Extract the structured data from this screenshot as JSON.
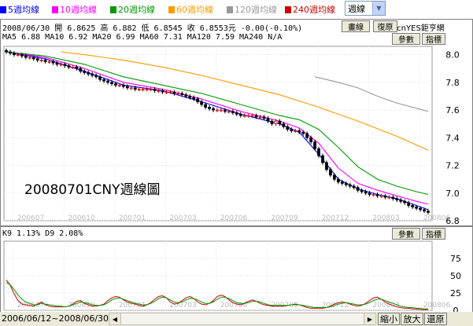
{
  "legend": [
    {
      "label": "5週均線",
      "color": "#0000ff"
    },
    {
      "label": "10週均線",
      "color": "#ff00ff"
    },
    {
      "label": "20週均線",
      "color": "#009900"
    },
    {
      "label": "60週均線",
      "color": "#ff9900"
    },
    {
      "label": "120週均線",
      "color": "#999999"
    },
    {
      "label": "240週均線",
      "color": "#cc0000"
    }
  ],
  "period_select": {
    "value": "週線"
  },
  "main_panel": {
    "info": "2008/06/30 開 6.8625 高 6.882 低 6.8545 收 6.8553元 -0.00(-0.10%)",
    "ma": "MA5 6.88  MA10 6.92  MA20 6.99  MA60 7.31  MA120 7.59  MA240 N/A",
    "copyright": "© cnYES鉅亨網",
    "buttons": {
      "draw": "畫線",
      "restore": "復原",
      "params": "參數",
      "indicator": "指標"
    },
    "watermark": "20080701CNY週線圖"
  },
  "sub_panel": {
    "info": "K9 1.13%  D9 2.08%",
    "buttons": {
      "params": "參數",
      "indicator": "指標"
    }
  },
  "bottom_bar": {
    "range": "2006/06/12~2008/06/30",
    "zoom_out": "縮小",
    "zoom_in": "放大",
    "reset": "還原"
  },
  "chart_data": [
    {
      "type": "candlestick",
      "x_ticks": [
        "200607",
        "200610",
        "200701",
        "200703",
        "200706",
        "200709",
        "200712",
        "200803",
        "200806"
      ],
      "y_ticks": [
        6.8,
        7.0,
        7.2,
        7.4,
        7.6,
        7.8,
        8.0
      ],
      "ylim": [
        6.8,
        8.06
      ],
      "close": [
        8.02,
        8.01,
        8.0,
        8.0,
        7.99,
        7.98,
        7.98,
        7.97,
        7.96,
        7.96,
        7.95,
        7.95,
        7.94,
        7.93,
        7.93,
        7.92,
        7.91,
        7.91,
        7.9,
        7.88,
        7.87,
        7.86,
        7.85,
        7.84,
        7.82,
        7.81,
        7.8,
        7.79,
        7.78,
        7.78,
        7.77,
        7.76,
        7.76,
        7.75,
        7.75,
        7.75,
        7.75,
        7.75,
        7.74,
        7.74,
        7.73,
        7.73,
        7.73,
        7.72,
        7.72,
        7.71,
        7.7,
        7.69,
        7.68,
        7.66,
        7.64,
        7.62,
        7.61,
        7.6,
        7.6,
        7.6,
        7.59,
        7.59,
        7.58,
        7.57,
        7.56,
        7.56,
        7.56,
        7.56,
        7.55,
        7.55,
        7.54,
        7.52,
        7.5,
        7.52,
        7.5,
        7.48,
        7.46,
        7.45,
        7.45,
        7.44,
        7.43,
        7.4,
        7.37,
        7.32,
        7.27,
        7.22,
        7.17,
        7.13,
        7.1,
        7.08,
        7.07,
        7.06,
        7.05,
        7.04,
        7.02,
        7.01,
        7.0,
        6.99,
        6.99,
        6.98,
        6.98,
        6.97,
        6.97,
        6.96,
        6.95,
        6.94,
        6.93,
        6.91,
        6.9,
        6.89,
        6.88,
        6.87,
        6.86
      ],
      "ma_series": [
        {
          "name": "5週均線",
          "points": [
            [
              0,
              8.02
            ],
            [
              10,
              7.97
            ],
            [
              20,
              7.88
            ],
            [
              30,
              7.78
            ],
            [
              40,
              7.74
            ],
            [
              50,
              7.66
            ],
            [
              60,
              7.57
            ],
            [
              70,
              7.5
            ],
            [
              75,
              7.44
            ],
            [
              80,
              7.28
            ],
            [
              85,
              7.1
            ],
            [
              90,
              7.03
            ],
            [
              95,
              6.99
            ],
            [
              100,
              6.96
            ],
            [
              105,
              6.91
            ],
            [
              108,
              6.88
            ]
          ]
        },
        {
          "name": "10週均線",
          "points": [
            [
              0,
              8.02
            ],
            [
              10,
              7.98
            ],
            [
              20,
              7.9
            ],
            [
              30,
              7.8
            ],
            [
              40,
              7.75
            ],
            [
              50,
              7.68
            ],
            [
              60,
              7.59
            ],
            [
              70,
              7.52
            ],
            [
              75,
              7.47
            ],
            [
              80,
              7.36
            ],
            [
              85,
              7.18
            ],
            [
              90,
              7.07
            ],
            [
              95,
              7.02
            ],
            [
              100,
              6.98
            ],
            [
              105,
              6.94
            ],
            [
              108,
              6.92
            ]
          ]
        },
        {
          "name": "20週均線",
          "points": [
            [
              0,
              8.02
            ],
            [
              10,
              7.99
            ],
            [
              20,
              7.93
            ],
            [
              30,
              7.84
            ],
            [
              40,
              7.78
            ],
            [
              50,
              7.72
            ],
            [
              60,
              7.64
            ],
            [
              70,
              7.56
            ],
            [
              75,
              7.53
            ],
            [
              80,
              7.46
            ],
            [
              85,
              7.33
            ],
            [
              90,
              7.19
            ],
            [
              95,
              7.1
            ],
            [
              100,
              7.05
            ],
            [
              105,
              7.01
            ],
            [
              108,
              6.99
            ]
          ]
        },
        {
          "name": "60週均線",
          "points": [
            [
              14,
              8.02
            ],
            [
              20,
              8.0
            ],
            [
              30,
              7.96
            ],
            [
              40,
              7.91
            ],
            [
              50,
              7.85
            ],
            [
              60,
              7.78
            ],
            [
              70,
              7.71
            ],
            [
              80,
              7.62
            ],
            [
              90,
              7.52
            ],
            [
              100,
              7.41
            ],
            [
              108,
              7.31
            ]
          ]
        },
        {
          "name": "120週均線",
          "points": [
            [
              79,
              7.84
            ],
            [
              85,
              7.8
            ],
            [
              90,
              7.76
            ],
            [
              95,
              7.7
            ],
            [
              100,
              7.65
            ],
            [
              108,
              7.59
            ]
          ]
        }
      ]
    },
    {
      "type": "line",
      "series": [
        {
          "name": "K9",
          "color": "#cc0000"
        },
        {
          "name": "D9",
          "color": "#009900"
        }
      ],
      "ylim": [
        0,
        100
      ],
      "y_ticks": [
        0,
        25,
        50,
        75
      ],
      "x_ticks": [
        "200607",
        "200610",
        "200701",
        "200703",
        "200706",
        "200709",
        "200712",
        "200803",
        "200806"
      ],
      "k": [
        44,
        36,
        24,
        14,
        9,
        8,
        7,
        6,
        9,
        12,
        8,
        6,
        5,
        5,
        5,
        5,
        6,
        9,
        13,
        14,
        10,
        8,
        6,
        6,
        7,
        9,
        14,
        18,
        20,
        19,
        15,
        12,
        10,
        9,
        7,
        6,
        8,
        11,
        16,
        20,
        21,
        18,
        12,
        9,
        10,
        14,
        18,
        20,
        17,
        12,
        9,
        8,
        10,
        14,
        20,
        22,
        20,
        15,
        11,
        9,
        8,
        10,
        13,
        15,
        13,
        10,
        8,
        7,
        6,
        6,
        6,
        6,
        7,
        8,
        9,
        8,
        6,
        4,
        3,
        3,
        3,
        3,
        4,
        6,
        9,
        11,
        12,
        11,
        9,
        7,
        6,
        7,
        10,
        14,
        18,
        19,
        16,
        12,
        9,
        7,
        5,
        4,
        3,
        3,
        2,
        2,
        1,
        1,
        1
      ],
      "d": [
        40,
        37,
        30,
        22,
        16,
        12,
        10,
        8,
        8,
        10,
        9,
        8,
        7,
        6,
        6,
        5,
        6,
        8,
        10,
        12,
        11,
        10,
        8,
        7,
        7,
        8,
        11,
        15,
        17,
        18,
        16,
        14,
        12,
        10,
        9,
        8,
        8,
        10,
        13,
        17,
        19,
        18,
        15,
        12,
        11,
        12,
        15,
        17,
        17,
        15,
        12,
        10,
        10,
        12,
        16,
        19,
        19,
        17,
        14,
        11,
        10,
        10,
        11,
        13,
        13,
        12,
        10,
        8,
        7,
        7,
        7,
        7,
        7,
        8,
        8,
        8,
        7,
        6,
        5,
        4,
        4,
        4,
        4,
        5,
        7,
        9,
        10,
        11,
        10,
        9,
        8,
        8,
        9,
        11,
        14,
        16,
        16,
        14,
        12,
        10,
        8,
        6,
        5,
        4,
        4,
        3,
        3,
        2,
        2
      ]
    }
  ]
}
